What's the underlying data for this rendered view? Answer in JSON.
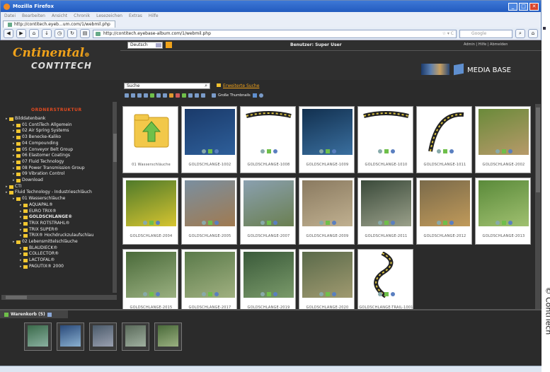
{
  "window": {
    "title": "Mozilla Firefox"
  },
  "menu": [
    "Datei",
    "Bearbeiten",
    "Ansicht",
    "Chronik",
    "Lesezeichen",
    "Extras",
    "Hilfe"
  ],
  "tab": {
    "label": "http://contitech.eyeb...um.com/1/webmil.php"
  },
  "address": {
    "url": "http://contitech.eyebase-album.com/1/webmil.php",
    "search_placeholder": "Google"
  },
  "header": {
    "logo_top": "ntinental",
    "logo_c": "C",
    "logo_bottom": "CONTITECH",
    "language": "Deutsch",
    "user_label": "Benutzer: Super User",
    "links": "Admin | Hilfe | Abmelden",
    "app_name": "MEDIA BASE"
  },
  "search": {
    "value": "Suche",
    "advanced_link": "Erweiterte Suche",
    "thumb_size": "Große Thumbnails"
  },
  "sidebar": {
    "heading": "ORDNERSTRUKTUR",
    "items": [
      {
        "label": "Bilddatenbank",
        "indent": 1
      },
      {
        "label": "01 ContiTech Allgemein",
        "indent": 2
      },
      {
        "label": "02 Air Spring Systems",
        "indent": 2
      },
      {
        "label": "03 Benecke-Kaliko",
        "indent": 2
      },
      {
        "label": "04 Compounding",
        "indent": 2
      },
      {
        "label": "05 Conveyor Belt Group",
        "indent": 2
      },
      {
        "label": "06 Elastomer Coatings",
        "indent": 2
      },
      {
        "label": "07 Fluid Technology",
        "indent": 2
      },
      {
        "label": "08 Power Transmission Group",
        "indent": 2
      },
      {
        "label": "09 Vibration Control",
        "indent": 2
      },
      {
        "label": "Download",
        "indent": 2
      },
      {
        "label": "CTI",
        "indent": 1
      },
      {
        "label": "Fluid Technology - Industrieschläuch",
        "indent": 1
      },
      {
        "label": "01 Wasserschläuche",
        "indent": 2
      },
      {
        "label": "AQUAPAL®",
        "indent": 3
      },
      {
        "label": "EURO TRIX®",
        "indent": 3
      },
      {
        "label": "GOLDSCHLANGE®",
        "indent": 3,
        "bold": true
      },
      {
        "label": "TRIX ROTSTRAHL®",
        "indent": 3
      },
      {
        "label": "TRIX SUPER®",
        "indent": 3
      },
      {
        "label": "TRIX® Hochdruckzulaufschlau",
        "indent": 3
      },
      {
        "label": "02 Lebensmittelschläuche",
        "indent": 2
      },
      {
        "label": "BLAUDIECK®",
        "indent": 3
      },
      {
        "label": "COLLECTOR®",
        "indent": 3
      },
      {
        "label": "LACTOFAL®",
        "indent": 3
      },
      {
        "label": "PAGUTIX® 2000",
        "indent": 3
      }
    ]
  },
  "thumbnails": [
    {
      "caption": "01 Wasserschläuche",
      "kind": "folder"
    },
    {
      "caption": "GOLDSCHLANGE-1002",
      "kind": "photo",
      "colors": [
        "#1a3a6a",
        "#2e5f9a"
      ]
    },
    {
      "caption": "GOLDSCHLANGE-1008",
      "kind": "hose"
    },
    {
      "caption": "GOLDSCHLANGE-1009",
      "kind": "photo",
      "colors": [
        "#12304f",
        "#3a6f9f"
      ]
    },
    {
      "caption": "GOLDSCHLANGE-1010",
      "kind": "hose"
    },
    {
      "caption": "GOLDSCHLANGE-1011",
      "kind": "arc"
    },
    {
      "caption": "GOLDSCHLANGE-2002",
      "kind": "photo",
      "colors": [
        "#6a8a3a",
        "#b79a6a"
      ]
    },
    {
      "caption": "GOLDSCHLANGE-2004",
      "kind": "photo",
      "colors": [
        "#4f7a2a",
        "#d6c430"
      ]
    },
    {
      "caption": "GOLDSCHLANGE-2005",
      "kind": "photo",
      "colors": [
        "#7a8fa0",
        "#a07a50"
      ]
    },
    {
      "caption": "GOLDSCHLANGE-2007",
      "kind": "photo",
      "colors": [
        "#8aa0b0",
        "#6a7f50"
      ]
    },
    {
      "caption": "GOLDSCHLANGE-2009",
      "kind": "photo",
      "colors": [
        "#8a7a60",
        "#c0b090"
      ]
    },
    {
      "caption": "GOLDSCHLANGE-2011",
      "kind": "photo",
      "colors": [
        "#3a4a3a",
        "#9aa08a"
      ]
    },
    {
      "caption": "GOLDSCHLANGE-2012",
      "kind": "photo",
      "colors": [
        "#7a6a4a",
        "#c09a5a"
      ]
    },
    {
      "caption": "GOLDSCHLANGE-2013",
      "kind": "photo",
      "colors": [
        "#5a8a3a",
        "#a0c070"
      ]
    },
    {
      "caption": "GOLDSCHLANGE-2015",
      "kind": "photo",
      "colors": [
        "#4a6a3a",
        "#9ab080"
      ]
    },
    {
      "caption": "GOLDSCHLANGE-2017",
      "kind": "photo",
      "colors": [
        "#5a7a4a",
        "#a0b080"
      ]
    },
    {
      "caption": "GOLDSCHLANGE-2019",
      "kind": "photo",
      "colors": [
        "#3a5a3a",
        "#7a9a6a"
      ]
    },
    {
      "caption": "GOLDSCHLANGE-2020",
      "kind": "photo",
      "colors": [
        "#5a6a4a",
        "#a09a70"
      ]
    },
    {
      "caption": "GOLDSCHLANGE-TRAIL-1001",
      "kind": "swirl"
    }
  ],
  "cart": {
    "label": "Warenkorb (5)",
    "items": [
      {
        "colors": [
          "#3a6a4a",
          "#8ab0a0"
        ]
      },
      {
        "colors": [
          "#2a4a7a",
          "#8ab0d0"
        ]
      },
      {
        "colors": [
          "#4a5a6a",
          "#9aa0b0"
        ]
      },
      {
        "colors": [
          "#5a6a5a",
          "#a0b0a0"
        ]
      },
      {
        "colors": [
          "#4a6a3a",
          "#9ab080"
        ]
      }
    ]
  },
  "copyright": "© ContiTech"
}
